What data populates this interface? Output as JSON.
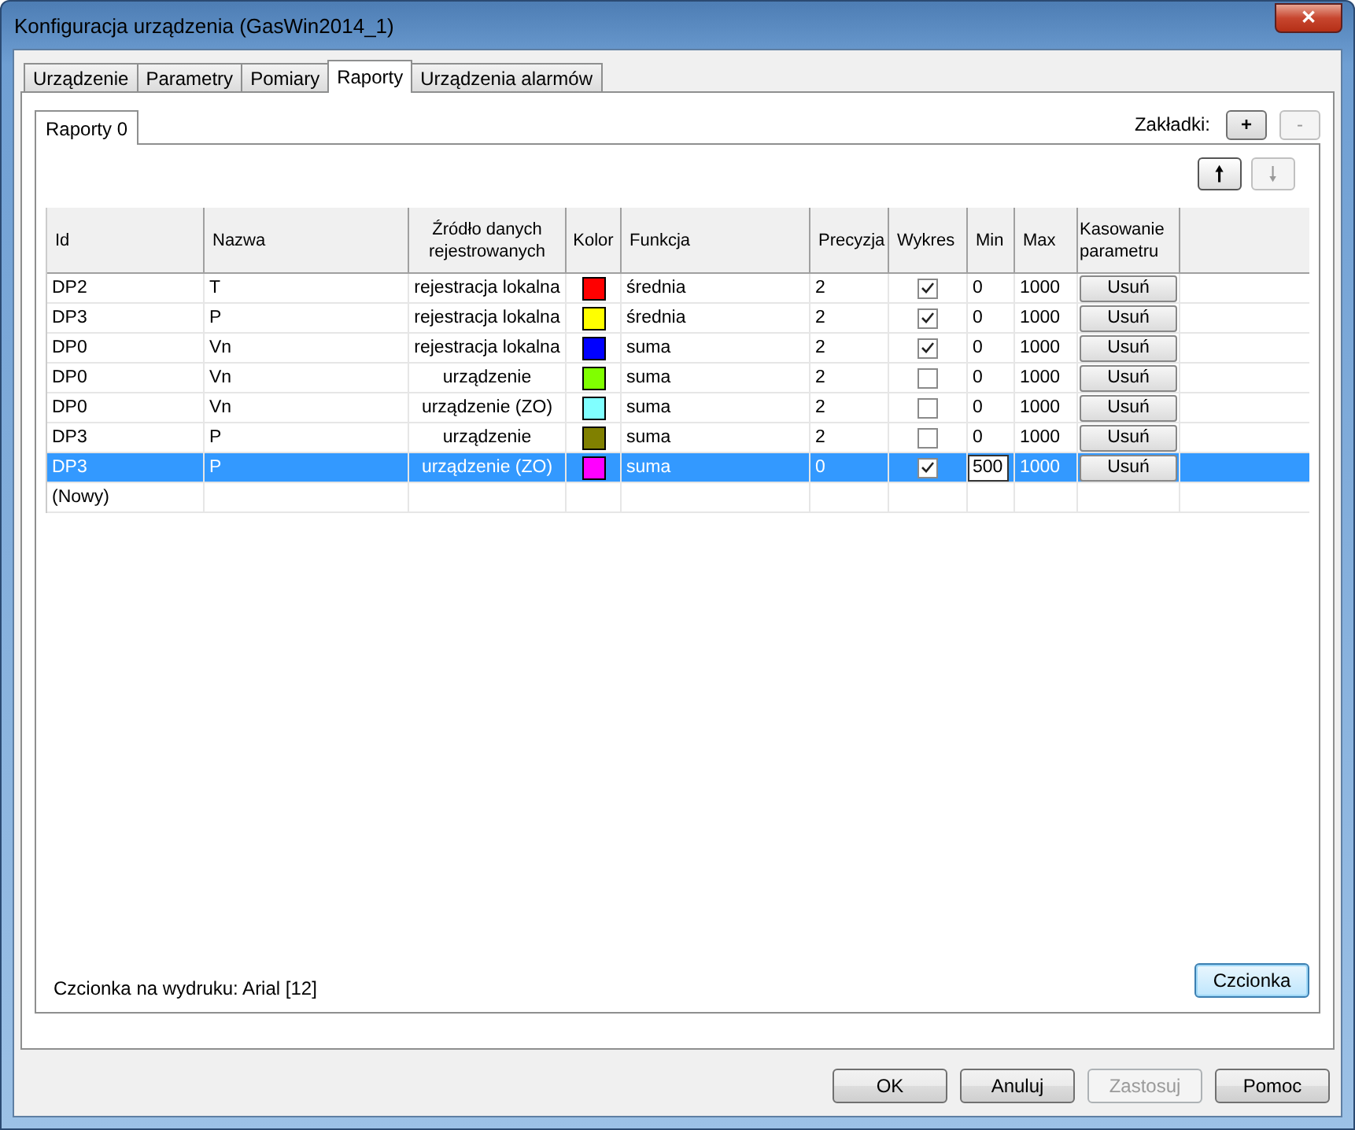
{
  "window": {
    "title": "Konfiguracja urządzenia (GasWin2014_1)",
    "close": "✕"
  },
  "tabs": [
    {
      "label": "Urządzenie",
      "selected": false
    },
    {
      "label": "Parametry",
      "selected": false
    },
    {
      "label": "Pomiary",
      "selected": false
    },
    {
      "label": "Raporty",
      "selected": true
    },
    {
      "label": "Urządzenia alarmów",
      "selected": false
    }
  ],
  "report_tabs": [
    {
      "label": "Raporty 0",
      "selected": true
    }
  ],
  "bookmarks": {
    "label": "Zakładki:",
    "add": "+",
    "remove": "-",
    "remove_disabled": true
  },
  "move": {
    "up": "🠕",
    "down": "🠗",
    "up_disabled": false,
    "down_disabled": true
  },
  "table": {
    "columns": [
      "Id",
      "Nazwa",
      "Źródło danych rejestrowanych",
      "Kolor",
      "Funkcja",
      "Precyzja",
      "Wykres",
      "Min",
      "Max",
      "Kasowanie parametru"
    ],
    "rows": [
      {
        "id": "DP2",
        "name": "T",
        "source": "rejestracja lokalna",
        "color": "#ff0000",
        "function": "średnia",
        "precision": "2",
        "chart": true,
        "min": "0",
        "min_editing": false,
        "max": "1000",
        "delete": "Usuń",
        "selected": false
      },
      {
        "id": "DP3",
        "name": "P",
        "source": "rejestracja lokalna",
        "color": "#ffff00",
        "function": "średnia",
        "precision": "2",
        "chart": true,
        "min": "0",
        "min_editing": false,
        "max": "1000",
        "delete": "Usuń",
        "selected": false
      },
      {
        "id": "DP0",
        "name": "Vn",
        "source": "rejestracja lokalna",
        "color": "#0000ff",
        "function": "suma",
        "precision": "2",
        "chart": true,
        "min": "0",
        "min_editing": false,
        "max": "1000",
        "delete": "Usuń",
        "selected": false
      },
      {
        "id": "DP0",
        "name": "Vn",
        "source": "urządzenie",
        "color": "#80ff00",
        "function": "suma",
        "precision": "2",
        "chart": false,
        "min": "0",
        "min_editing": false,
        "max": "1000",
        "delete": "Usuń",
        "selected": false
      },
      {
        "id": "DP0",
        "name": "Vn",
        "source": "urządzenie (ZO)",
        "color": "#80ffff",
        "function": "suma",
        "precision": "2",
        "chart": false,
        "min": "0",
        "min_editing": false,
        "max": "1000",
        "delete": "Usuń",
        "selected": false
      },
      {
        "id": "DP3",
        "name": "P",
        "source": "urządzenie",
        "color": "#808000",
        "function": "suma",
        "precision": "2",
        "chart": false,
        "min": "0",
        "min_editing": false,
        "max": "1000",
        "delete": "Usuń",
        "selected": false
      },
      {
        "id": "DP3",
        "name": "P",
        "source": "urządzenie (ZO)",
        "color": "#ff00ff",
        "function": "suma",
        "precision": "0",
        "chart": true,
        "min": "500",
        "min_editing": true,
        "max": "1000",
        "delete": "Usuń",
        "selected": true
      }
    ],
    "new_row": "(Nowy)"
  },
  "font_info": "Czcionka na wydruku: Arial [12]",
  "font_button": "Czcionka",
  "buttons": [
    {
      "label": "OK",
      "disabled": false
    },
    {
      "label": "Anuluj",
      "disabled": false
    },
    {
      "label": "Zastosuj",
      "disabled": true
    },
    {
      "label": "Pomoc",
      "disabled": false
    }
  ]
}
